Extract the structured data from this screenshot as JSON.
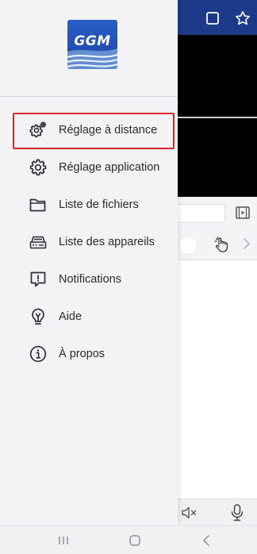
{
  "drawer": {
    "logo_text": "GGM",
    "menu_items": [
      {
        "label": "Réglage à distance",
        "icon": "remote-settings-icon",
        "selected": true
      },
      {
        "label": "Réglage application",
        "icon": "gear-icon",
        "selected": false
      },
      {
        "label": "Liste de fichiers",
        "icon": "folder-icon",
        "selected": false
      },
      {
        "label": "Liste des appareils",
        "icon": "device-list-icon",
        "selected": false
      },
      {
        "label": "Notifications",
        "icon": "notification-icon",
        "selected": false
      },
      {
        "label": "Aide",
        "icon": "help-bulb-icon",
        "selected": false
      },
      {
        "label": "À propos",
        "icon": "info-icon",
        "selected": false
      }
    ]
  },
  "colors": {
    "brand_blue": "#1d3a8a",
    "highlight_red": "#d8262f",
    "icon_dark": "#2b2f3a"
  },
  "system_nav": {
    "buttons": [
      "recent-apps-icon",
      "home-icon",
      "back-icon"
    ]
  }
}
